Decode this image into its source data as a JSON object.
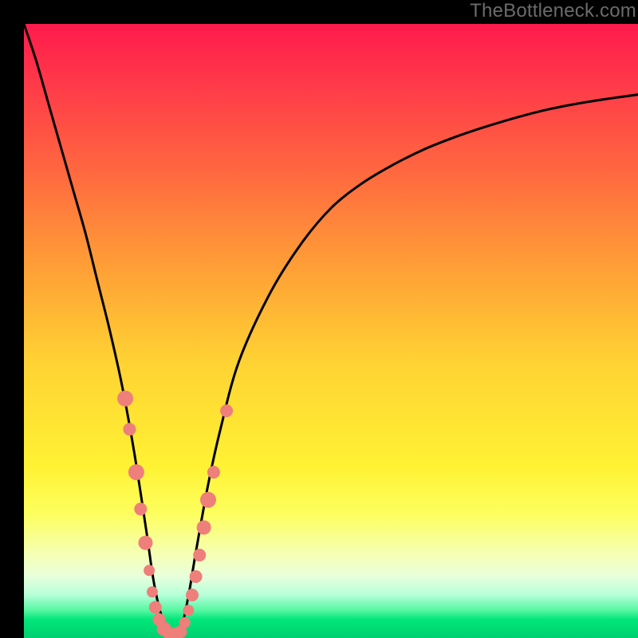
{
  "watermark": "TheBottleneck.com",
  "chart_data": {
    "type": "line",
    "title": "",
    "xlabel": "",
    "ylabel": "",
    "xlim": [
      0,
      100
    ],
    "ylim": [
      0,
      100
    ],
    "series": [
      {
        "name": "bottleneck-curve",
        "x": [
          0,
          2,
          4,
          6,
          8,
          10,
          12,
          14,
          16,
          18,
          20,
          21,
          22,
          23,
          24,
          25,
          26,
          27,
          28,
          30,
          32,
          35,
          40,
          45,
          50,
          55,
          60,
          65,
          70,
          75,
          80,
          85,
          90,
          95,
          100
        ],
        "y": [
          100,
          94,
          87,
          80,
          73,
          66,
          58,
          50,
          41,
          30,
          17,
          10,
          5,
          2,
          0,
          0,
          3,
          8,
          14,
          25,
          34,
          45,
          56,
          64,
          70,
          74,
          77,
          79.5,
          81.5,
          83.2,
          84.7,
          86,
          87,
          87.8,
          88.5
        ]
      }
    ],
    "markers": [
      {
        "pos": [
          16.5,
          39
        ],
        "r": 10
      },
      {
        "pos": [
          17.2,
          34
        ],
        "r": 8
      },
      {
        "pos": [
          18.3,
          27
        ],
        "r": 10
      },
      {
        "pos": [
          19.0,
          21
        ],
        "r": 8
      },
      {
        "pos": [
          19.8,
          15.5
        ],
        "r": 9
      },
      {
        "pos": [
          20.4,
          11
        ],
        "r": 7
      },
      {
        "pos": [
          20.9,
          7.5
        ],
        "r": 7
      },
      {
        "pos": [
          21.4,
          5.0
        ],
        "r": 8
      },
      {
        "pos": [
          22.0,
          3.0
        ],
        "r": 8
      },
      {
        "pos": [
          22.8,
          1.5
        ],
        "r": 9
      },
      {
        "pos": [
          23.6,
          0.8
        ],
        "r": 8
      },
      {
        "pos": [
          24.6,
          0.5
        ],
        "r": 9
      },
      {
        "pos": [
          25.5,
          1.0
        ],
        "r": 8
      },
      {
        "pos": [
          26.2,
          2.5
        ],
        "r": 7
      },
      {
        "pos": [
          26.8,
          4.5
        ],
        "r": 7
      },
      {
        "pos": [
          27.4,
          7
        ],
        "r": 8
      },
      {
        "pos": [
          28.0,
          10
        ],
        "r": 8
      },
      {
        "pos": [
          28.6,
          13.5
        ],
        "r": 8
      },
      {
        "pos": [
          29.3,
          18
        ],
        "r": 9
      },
      {
        "pos": [
          30.0,
          22.5
        ],
        "r": 10
      },
      {
        "pos": [
          30.9,
          27
        ],
        "r": 8
      },
      {
        "pos": [
          33.0,
          37
        ],
        "r": 8
      }
    ],
    "gradient_stops": [
      {
        "offset": 0,
        "color": "#ff1a4c"
      },
      {
        "offset": 10,
        "color": "#ff3a49"
      },
      {
        "offset": 25,
        "color": "#ff6b3f"
      },
      {
        "offset": 40,
        "color": "#ffa036"
      },
      {
        "offset": 55,
        "color": "#ffd233"
      },
      {
        "offset": 72,
        "color": "#fff233"
      },
      {
        "offset": 80,
        "color": "#fdff60"
      },
      {
        "offset": 86,
        "color": "#f6ffb0"
      },
      {
        "offset": 90,
        "color": "#e8ffdc"
      },
      {
        "offset": 93,
        "color": "#b5ffd8"
      },
      {
        "offset": 95.5,
        "color": "#56f7a2"
      },
      {
        "offset": 97,
        "color": "#00e67a"
      },
      {
        "offset": 100,
        "color": "#00d070"
      }
    ],
    "colors": {
      "curve": "#000000",
      "marker_fill": "#ee7f7b",
      "marker_stroke": "none",
      "background_frame": "#000000"
    }
  }
}
